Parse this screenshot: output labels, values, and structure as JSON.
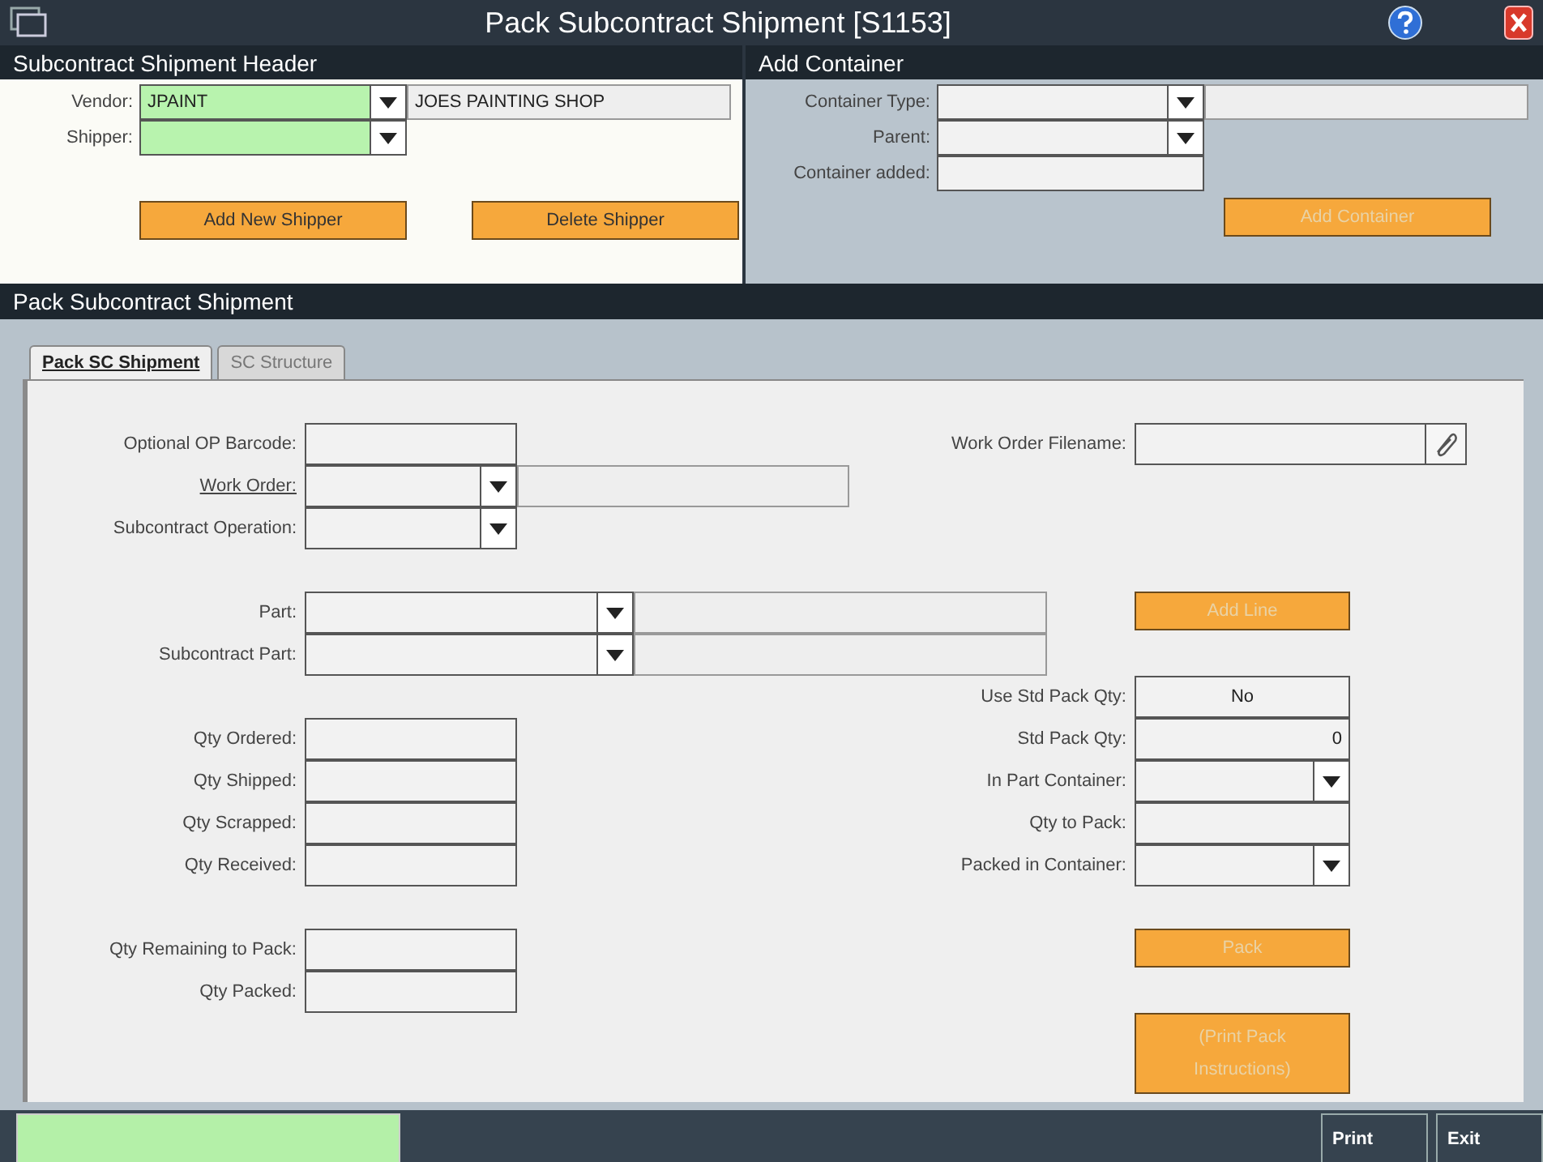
{
  "window": {
    "title": "Pack Subcontract Shipment [S1153]"
  },
  "shipment_header": {
    "title": "Subcontract Shipment Header",
    "rows": [
      {
        "label": "Vendor:",
        "kind": "lookup",
        "value": "JPAINT",
        "description": "JOES PAINTING SHOP",
        "required": true
      },
      {
        "label": "Shipper:",
        "kind": "combo",
        "required": true
      }
    ],
    "buttons": [
      {
        "label": "Add New Shipper",
        "disabled": false
      },
      {
        "label": "Delete Shipper",
        "disabled": false
      }
    ]
  },
  "add_container": {
    "title": "Add Container",
    "rows": [
      {
        "label": "Container Type:",
        "kind": "lookup"
      },
      {
        "label": "Parent:",
        "kind": "combo"
      },
      {
        "label": "Container added:",
        "kind": "text"
      }
    ],
    "buttons": [
      {
        "label": "Add Container",
        "disabled": true
      }
    ]
  },
  "section_title": "Pack Subcontract Shipment",
  "tabs": [
    {
      "label": "Pack SC Shipment",
      "selected": true
    },
    {
      "label": "SC Structure",
      "selected": false
    }
  ],
  "groups": [
    [
      {
        "left": {
          "label": "Optional OP Barcode:",
          "kind": "text",
          "link": false
        },
        "right": {
          "label": "Work Order Filename:",
          "kind": "file"
        }
      },
      {
        "left": {
          "label": "Work Order:",
          "kind": "lookup",
          "link": true
        }
      },
      {
        "left": {
          "label": "Subcontract Operation:",
          "kind": "combo",
          "link": false
        }
      }
    ],
    [
      {
        "left": {
          "label": "Part:",
          "kind": "widelookup",
          "link": false
        },
        "right": {
          "kind": "button",
          "label": "Add Line",
          "disabled": true
        }
      },
      {
        "left": {
          "label": "Subcontract Part:",
          "kind": "widelookup",
          "link": false
        }
      },
      {
        "right": {
          "label": "Use Std Pack Qty:",
          "kind": "toggle",
          "value": "No"
        }
      },
      {
        "left": {
          "label": "Qty Ordered:",
          "kind": "text",
          "link": false
        },
        "right": {
          "label": "Std Pack Qty:",
          "kind": "number",
          "value": "0"
        }
      },
      {
        "left": {
          "label": "Qty Shipped:",
          "kind": "text",
          "link": false
        },
        "right": {
          "label": "In Part Container:",
          "kind": "combo"
        }
      },
      {
        "left": {
          "label": "Qty Scrapped:",
          "kind": "text",
          "link": false
        },
        "right": {
          "label": "Qty to Pack:",
          "kind": "text"
        }
      },
      {
        "left": {
          "label": "Qty Received:",
          "kind": "text",
          "link": false
        },
        "right": {
          "label": "Packed in Container:",
          "kind": "combo"
        }
      }
    ],
    [
      {
        "left": {
          "label": "Qty Remaining to Pack:",
          "kind": "text",
          "link": false
        },
        "right": {
          "kind": "button",
          "label": "Pack",
          "disabled": true
        }
      },
      {
        "left": {
          "label": "Qty Packed:",
          "kind": "text",
          "link": false
        }
      },
      {
        "right": {
          "kind": "tallbutton",
          "label": "(Print Pack Instructions)",
          "disabled": true
        }
      }
    ]
  ],
  "footer": {
    "buttons": [
      "Print",
      "Exit"
    ]
  }
}
